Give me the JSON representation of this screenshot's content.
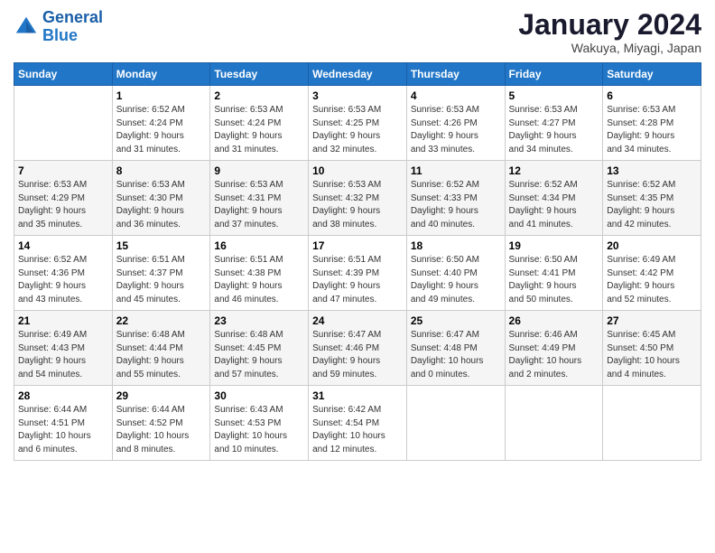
{
  "logo": {
    "line1": "General",
    "line2": "Blue"
  },
  "title": "January 2024",
  "location": "Wakuya, Miyagi, Japan",
  "days_header": [
    "Sunday",
    "Monday",
    "Tuesday",
    "Wednesday",
    "Thursday",
    "Friday",
    "Saturday"
  ],
  "weeks": [
    [
      {
        "num": "",
        "info": ""
      },
      {
        "num": "1",
        "info": "Sunrise: 6:52 AM\nSunset: 4:24 PM\nDaylight: 9 hours\nand 31 minutes."
      },
      {
        "num": "2",
        "info": "Sunrise: 6:53 AM\nSunset: 4:24 PM\nDaylight: 9 hours\nand 31 minutes."
      },
      {
        "num": "3",
        "info": "Sunrise: 6:53 AM\nSunset: 4:25 PM\nDaylight: 9 hours\nand 32 minutes."
      },
      {
        "num": "4",
        "info": "Sunrise: 6:53 AM\nSunset: 4:26 PM\nDaylight: 9 hours\nand 33 minutes."
      },
      {
        "num": "5",
        "info": "Sunrise: 6:53 AM\nSunset: 4:27 PM\nDaylight: 9 hours\nand 34 minutes."
      },
      {
        "num": "6",
        "info": "Sunrise: 6:53 AM\nSunset: 4:28 PM\nDaylight: 9 hours\nand 34 minutes."
      }
    ],
    [
      {
        "num": "7",
        "info": "Sunrise: 6:53 AM\nSunset: 4:29 PM\nDaylight: 9 hours\nand 35 minutes."
      },
      {
        "num": "8",
        "info": "Sunrise: 6:53 AM\nSunset: 4:30 PM\nDaylight: 9 hours\nand 36 minutes."
      },
      {
        "num": "9",
        "info": "Sunrise: 6:53 AM\nSunset: 4:31 PM\nDaylight: 9 hours\nand 37 minutes."
      },
      {
        "num": "10",
        "info": "Sunrise: 6:53 AM\nSunset: 4:32 PM\nDaylight: 9 hours\nand 38 minutes."
      },
      {
        "num": "11",
        "info": "Sunrise: 6:52 AM\nSunset: 4:33 PM\nDaylight: 9 hours\nand 40 minutes."
      },
      {
        "num": "12",
        "info": "Sunrise: 6:52 AM\nSunset: 4:34 PM\nDaylight: 9 hours\nand 41 minutes."
      },
      {
        "num": "13",
        "info": "Sunrise: 6:52 AM\nSunset: 4:35 PM\nDaylight: 9 hours\nand 42 minutes."
      }
    ],
    [
      {
        "num": "14",
        "info": "Sunrise: 6:52 AM\nSunset: 4:36 PM\nDaylight: 9 hours\nand 43 minutes."
      },
      {
        "num": "15",
        "info": "Sunrise: 6:51 AM\nSunset: 4:37 PM\nDaylight: 9 hours\nand 45 minutes."
      },
      {
        "num": "16",
        "info": "Sunrise: 6:51 AM\nSunset: 4:38 PM\nDaylight: 9 hours\nand 46 minutes."
      },
      {
        "num": "17",
        "info": "Sunrise: 6:51 AM\nSunset: 4:39 PM\nDaylight: 9 hours\nand 47 minutes."
      },
      {
        "num": "18",
        "info": "Sunrise: 6:50 AM\nSunset: 4:40 PM\nDaylight: 9 hours\nand 49 minutes."
      },
      {
        "num": "19",
        "info": "Sunrise: 6:50 AM\nSunset: 4:41 PM\nDaylight: 9 hours\nand 50 minutes."
      },
      {
        "num": "20",
        "info": "Sunrise: 6:49 AM\nSunset: 4:42 PM\nDaylight: 9 hours\nand 52 minutes."
      }
    ],
    [
      {
        "num": "21",
        "info": "Sunrise: 6:49 AM\nSunset: 4:43 PM\nDaylight: 9 hours\nand 54 minutes."
      },
      {
        "num": "22",
        "info": "Sunrise: 6:48 AM\nSunset: 4:44 PM\nDaylight: 9 hours\nand 55 minutes."
      },
      {
        "num": "23",
        "info": "Sunrise: 6:48 AM\nSunset: 4:45 PM\nDaylight: 9 hours\nand 57 minutes."
      },
      {
        "num": "24",
        "info": "Sunrise: 6:47 AM\nSunset: 4:46 PM\nDaylight: 9 hours\nand 59 minutes."
      },
      {
        "num": "25",
        "info": "Sunrise: 6:47 AM\nSunset: 4:48 PM\nDaylight: 10 hours\nand 0 minutes."
      },
      {
        "num": "26",
        "info": "Sunrise: 6:46 AM\nSunset: 4:49 PM\nDaylight: 10 hours\nand 2 minutes."
      },
      {
        "num": "27",
        "info": "Sunrise: 6:45 AM\nSunset: 4:50 PM\nDaylight: 10 hours\nand 4 minutes."
      }
    ],
    [
      {
        "num": "28",
        "info": "Sunrise: 6:44 AM\nSunset: 4:51 PM\nDaylight: 10 hours\nand 6 minutes."
      },
      {
        "num": "29",
        "info": "Sunrise: 6:44 AM\nSunset: 4:52 PM\nDaylight: 10 hours\nand 8 minutes."
      },
      {
        "num": "30",
        "info": "Sunrise: 6:43 AM\nSunset: 4:53 PM\nDaylight: 10 hours\nand 10 minutes."
      },
      {
        "num": "31",
        "info": "Sunrise: 6:42 AM\nSunset: 4:54 PM\nDaylight: 10 hours\nand 12 minutes."
      },
      {
        "num": "",
        "info": ""
      },
      {
        "num": "",
        "info": ""
      },
      {
        "num": "",
        "info": ""
      }
    ]
  ]
}
